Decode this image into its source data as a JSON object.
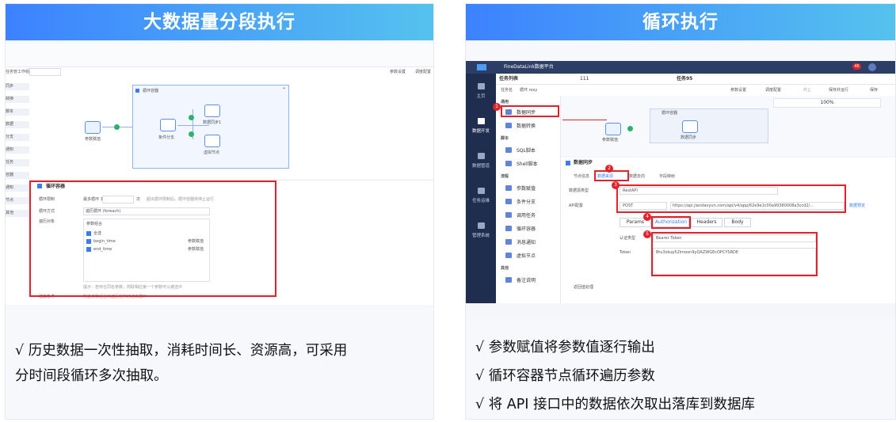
{
  "left": {
    "banner_title": "大数据量分段执行",
    "shot": {
      "task_name_label": "任务管工作组",
      "param_btn": "参数设置",
      "view_btn": "调度配置",
      "container_title": "循环容器",
      "node_param": "参数赋值",
      "node_cond": "条件分支",
      "node_sync": "数据同步1",
      "node_virtual": "虚拟节点",
      "sidebar": [
        "同步",
        "转换",
        "脚本",
        "数据",
        "分支",
        "通知",
        "任务",
        "容器",
        "通知",
        "节点",
        "其他"
      ],
      "panel_title": "循环容器",
      "fields": [
        {
          "label": "循环限制",
          "value": "最多循环   128",
          "suffix": "次",
          "hint": "超出循环限制后，循环容器将停止运行"
        },
        {
          "label": "循环方式",
          "value": "遍历循环 (foreach)"
        },
        {
          "label": "遍历对象",
          "value": "参数组合"
        }
      ],
      "check_items": [
        {
          "name": "全选",
          "value": ""
        },
        {
          "name": "begin_time",
          "value": "参数赋值"
        },
        {
          "name": "end_time",
          "value": "参数赋值"
        }
      ],
      "tip": "提示：若存在同名参数，则取相应第一个参数可以被选中",
      "exit_label": "结束条件",
      "exit_value": "所选参数组合均遍历完毕时结束循环"
    },
    "bullets": [
      "√ 历史数据一次性抽取，消耗时间长、资源高，可采用",
      "分时间段循环多次抽取。"
    ]
  },
  "right": {
    "banner_title": "循环执行",
    "shot": {
      "app_title": "FineDataLink数据平台",
      "badge": "46",
      "nav": [
        "主页",
        "数据开发",
        "数据管道",
        "任务运维",
        "管理系统"
      ],
      "task_list_title": "任务列表",
      "tab1": "111",
      "tab2": "任务95",
      "task_name_label": "任务名",
      "task_name_value": "循环 roxy",
      "toolbar": [
        "参数设置",
        "调度配置",
        "终止",
        "保存并运行",
        "保存"
      ],
      "zoom": "100%",
      "groups": [
        {
          "title": "通用",
          "items": [
            "数据同步",
            "数据转换"
          ]
        },
        {
          "title": "脚本",
          "items": [
            "SQL脚本",
            "Shell脚本"
          ]
        },
        {
          "title": "流程",
          "items": [
            "参数赋值",
            "条件分支",
            "调用任务",
            "循环容器",
            "消息通知",
            "虚拟节点"
          ]
        },
        {
          "title": "其他",
          "items": [
            "备注说明"
          ]
        }
      ],
      "canvas_node_param": "参数赋值",
      "canvas_container": "循环容器",
      "canvas_sync": "数据同步",
      "panel_title": "数据同步",
      "panel_tabs": [
        "节点信息",
        "数据来源",
        "数据去向",
        "字段映射"
      ],
      "source_type_label": "数据源类型",
      "source_type_value": "RestAPI",
      "api_label": "API配置",
      "method": "POST",
      "url": "https://api.jiandaoyun.com/api/v4/app/62e9e1c00a99380008a3ccd2/...",
      "preview": "数据预览",
      "req_tabs": [
        "Params",
        "Authorization",
        "Headers",
        "Body"
      ],
      "auth_type_label": "认证类型",
      "auth_type_value": "Bearer Token",
      "token_label": "Token",
      "token_value": "Btu3skup52lmoon9yQAZWGEcOPCYSRDE",
      "return_label": "返回值处理",
      "markers": [
        "1",
        "2",
        "3",
        "4",
        "5"
      ]
    },
    "bullets": [
      "√  参数赋值将参数值逐行输出",
      "√ 循环容器节点循环遍历参数",
      "√ 将 API 接口中的数据依次取出落库到数据库"
    ]
  }
}
